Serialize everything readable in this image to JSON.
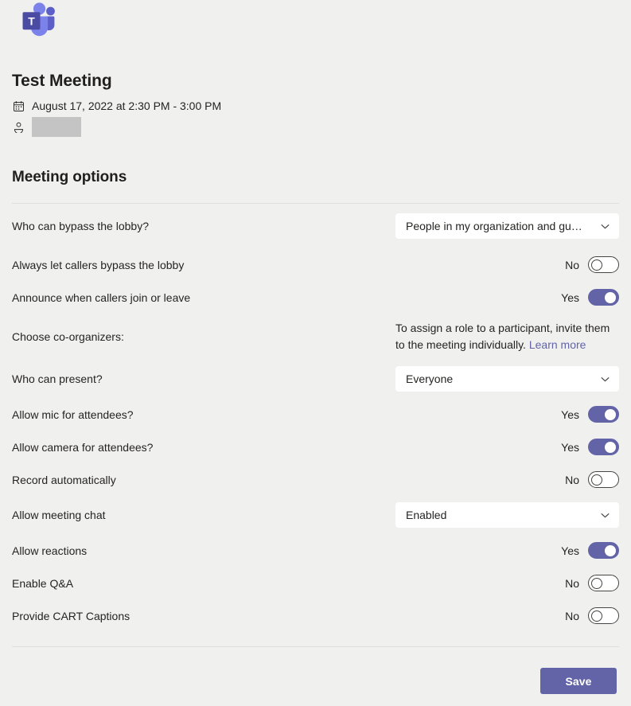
{
  "app": {
    "logo_name": "microsoft-teams-logo",
    "logo_letter": "T",
    "colors": {
      "brand_purple": "#6264a7",
      "logo_dark": "#4b4ba3",
      "logo_light": "#7b83eb",
      "background": "#f0f0ef",
      "divider": "#e1dfdd",
      "link": "#6264a7",
      "text": "#252423"
    }
  },
  "header": {
    "title": "Test Meeting",
    "datetime": "August 17, 2022 at 2:30 PM - 3:00 PM",
    "datetime_icon": "calendar-icon",
    "organizer_icon": "person-icon",
    "organizer_value": ""
  },
  "section": {
    "title": "Meeting options"
  },
  "options": [
    {
      "label": "Who can bypass the lobby?",
      "control": "dropdown",
      "value": "People in my organization and gu…",
      "name": "who-can-bypass-lobby"
    },
    {
      "label": "Always let callers bypass the lobby",
      "control": "toggle",
      "value": "No",
      "on": false,
      "name": "always-let-callers-bypass-lobby"
    },
    {
      "label": "Announce when callers join or leave",
      "control": "toggle",
      "value": "Yes",
      "on": true,
      "name": "announce-callers-join-leave"
    },
    {
      "label": "Choose co-organizers:",
      "control": "note",
      "note_text": "To assign a role to a participant, invite them to the meeting individually. ",
      "note_link": "Learn more",
      "name": "choose-co-organizers"
    },
    {
      "label": "Who can present?",
      "control": "dropdown",
      "value": "Everyone",
      "name": "who-can-present"
    },
    {
      "label": "Allow mic for attendees?",
      "control": "toggle",
      "value": "Yes",
      "on": true,
      "name": "allow-mic-for-attendees"
    },
    {
      "label": "Allow camera for attendees?",
      "control": "toggle",
      "value": "Yes",
      "on": true,
      "name": "allow-camera-for-attendees"
    },
    {
      "label": "Record automatically",
      "control": "toggle",
      "value": "No",
      "on": false,
      "name": "record-automatically"
    },
    {
      "label": "Allow meeting chat",
      "control": "dropdown",
      "value": "Enabled",
      "name": "allow-meeting-chat"
    },
    {
      "label": "Allow reactions",
      "control": "toggle",
      "value": "Yes",
      "on": true,
      "name": "allow-reactions"
    },
    {
      "label": "Enable Q&A",
      "control": "toggle",
      "value": "No",
      "on": false,
      "name": "enable-qna"
    },
    {
      "label": "Provide CART Captions",
      "control": "toggle",
      "value": "No",
      "on": false,
      "name": "provide-cart-captions"
    }
  ],
  "footer": {
    "save_label": "Save"
  }
}
